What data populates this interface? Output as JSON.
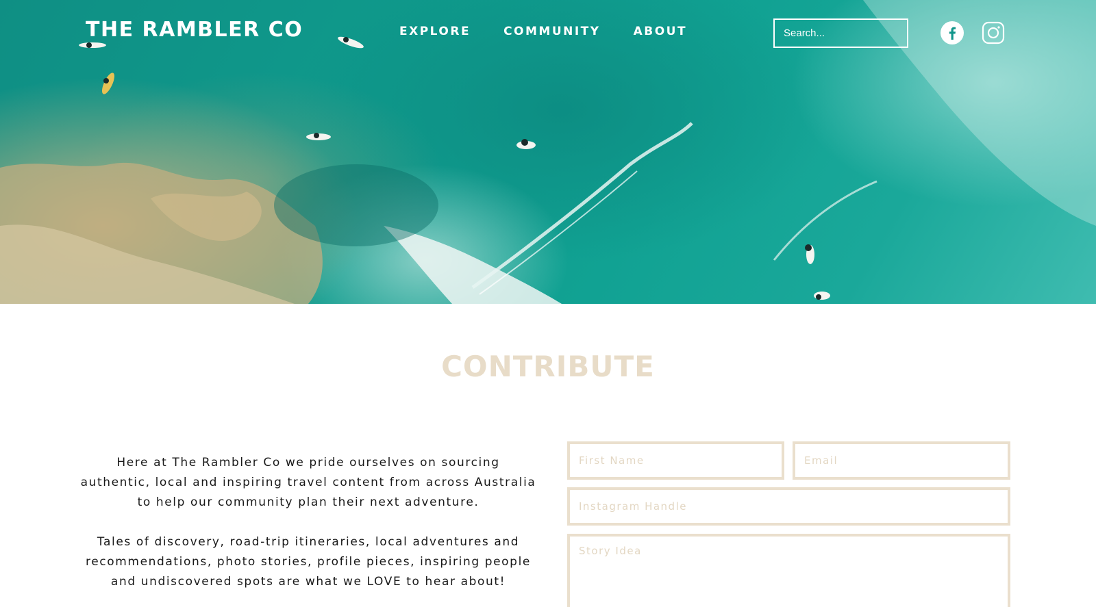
{
  "header": {
    "logo": "THE RAMBLER CO",
    "nav": [
      {
        "label": "EXPLORE"
      },
      {
        "label": "COMMUNITY"
      },
      {
        "label": "ABOUT"
      }
    ],
    "search": {
      "placeholder": "Search...",
      "value": ""
    },
    "social": [
      {
        "icon": "facebook-icon"
      },
      {
        "icon": "instagram-icon"
      }
    ]
  },
  "hero": {
    "image": "aerial-ocean-surfers"
  },
  "main": {
    "title": "CONTRIBUTE",
    "intro": [
      "Here at The Rambler Co we pride ourselves on sourcing authentic, local and inspiring travel content from across Australia to help our community plan their next adventure.",
      "Tales of discovery, road-trip itineraries, local adventures and recommendations, photo stories, profile pieces, inspiring people and undiscovered spots are what we LOVE to hear about!"
    ],
    "form": {
      "first_name": {
        "placeholder": "First Name",
        "value": ""
      },
      "email": {
        "placeholder": "Email",
        "value": ""
      },
      "instagram": {
        "placeholder": "Instagram Handle",
        "value": ""
      },
      "story": {
        "placeholder": "Story Idea",
        "value": ""
      }
    }
  },
  "colors": {
    "accent_beige": "#e8dcc8",
    "field_border": "#eadfcd",
    "ocean": "#0f9a8c"
  }
}
